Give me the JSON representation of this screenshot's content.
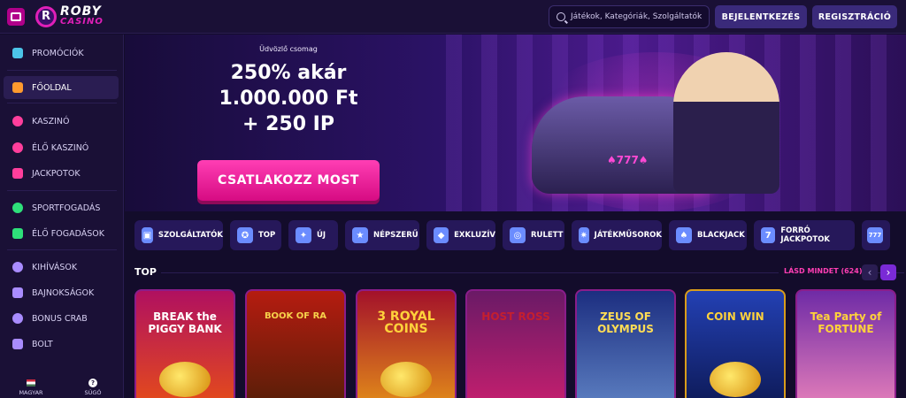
{
  "header": {
    "logo_main": "ROBY",
    "logo_sub": "CASINO",
    "search_placeholder": "Játékok, Kategóriák, Szolgáltatók",
    "login_label": "BEJELENTKEZÉS",
    "register_label": "REGISZTRÁCIÓ"
  },
  "sidebar": {
    "items": [
      {
        "label": "PROMÓCIÓK",
        "icon": "gift-icon",
        "color": "#4cc4e8"
      },
      {
        "label": "FŐOLDAL",
        "icon": "home-icon",
        "color": "#ff9a2e"
      },
      {
        "label": "KASZINÓ",
        "icon": "casino-chip-icon",
        "color": "#ff3e9c"
      },
      {
        "label": "ÉLŐ KASZINÓ",
        "icon": "dealer-icon",
        "color": "#ff3e9c"
      },
      {
        "label": "JACKPOTOK",
        "icon": "seven-icon",
        "color": "#ff3e9c"
      },
      {
        "label": "SPORTFOGADÁS",
        "icon": "ball-icon",
        "color": "#2ee07a"
      },
      {
        "label": "ÉLŐ FOGADÁSOK",
        "icon": "ticket-icon",
        "color": "#2ee07a"
      },
      {
        "label": "KIHÍVÁSOK",
        "icon": "medal-icon",
        "color": "#a98cff"
      },
      {
        "label": "BAJNOKSÁGOK",
        "icon": "trophy-icon",
        "color": "#a98cff"
      },
      {
        "label": "BONUS CRAB",
        "icon": "crab-icon",
        "color": "#a98cff"
      },
      {
        "label": "BOLT",
        "icon": "cart-icon",
        "color": "#a98cff"
      }
    ],
    "language": "MAGYAR",
    "help": "SÚGÓ"
  },
  "hero": {
    "subtitle": "Üdvözlő csomag",
    "line1": "250% akár",
    "line2": "1.000.000 Ft",
    "line3": "+ 250 IP",
    "cta": "CSATLAKOZZ MOST",
    "bike_label": "♠777♠"
  },
  "categories": [
    {
      "label": "SZOLGÁLTATÓK",
      "icon": "folder-icon",
      "glyph": "▣"
    },
    {
      "label": "TOP",
      "icon": "award-icon",
      "glyph": "✪"
    },
    {
      "label": "ÚJ",
      "icon": "sparkle-icon",
      "glyph": "✦"
    },
    {
      "label": "NÉPSZERŰ",
      "icon": "star-icon",
      "glyph": "★"
    },
    {
      "label": "EXKLUZÍV",
      "icon": "diamond-icon",
      "glyph": "◆"
    },
    {
      "label": "RULETT",
      "icon": "roulette-icon",
      "glyph": "◎"
    },
    {
      "label": "JÁTÉKMŰSOROK",
      "icon": "wheel-icon",
      "glyph": "✷"
    },
    {
      "label": "BLACKJACK",
      "icon": "spade-icon",
      "glyph": "♠"
    },
    {
      "label": "FORRÓ JACKPOTOK",
      "icon": "seven-icon",
      "glyph": "7"
    },
    {
      "label": "",
      "icon": "slot-777-icon",
      "glyph": "777"
    }
  ],
  "top_section": {
    "title": "TOP",
    "see_all": "LÁSD MINDET (624)",
    "prev": "‹",
    "next": "›"
  },
  "games": [
    {
      "title": "BREAK the PIGGY BANK"
    },
    {
      "title": "BOOK OF RA"
    },
    {
      "title": "3 ROYAL COINS"
    },
    {
      "title": "HOST ROSS"
    },
    {
      "title": "ZEUS OF OLYMPUS"
    },
    {
      "title": "COIN WIN"
    },
    {
      "title": "Tea Party of FORTUNE"
    }
  ]
}
